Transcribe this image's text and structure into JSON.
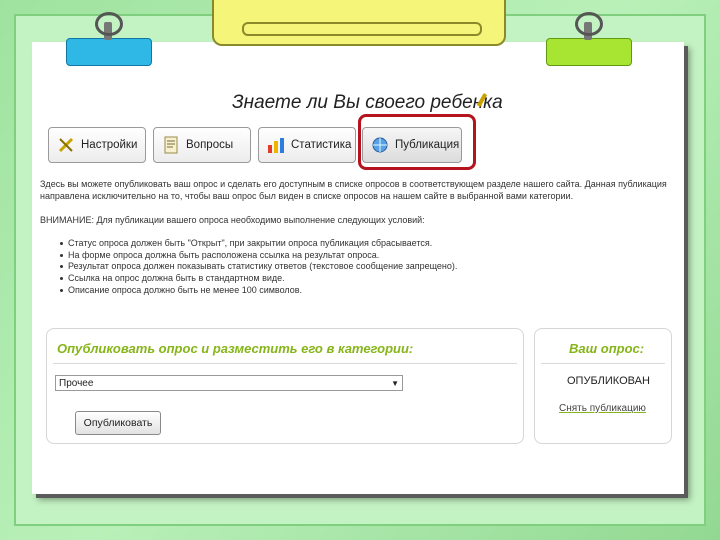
{
  "page": {
    "title": "Знаете ли Вы своего ребенка"
  },
  "tabs": [
    {
      "label": "Настройки",
      "icon": "tools-icon"
    },
    {
      "label": "Вопросы",
      "icon": "document-icon"
    },
    {
      "label": "Статистика",
      "icon": "chart-icon"
    },
    {
      "label": "Публикация",
      "icon": "globe-icon"
    }
  ],
  "content": {
    "intro_line1": "Здесь вы можете опубликовать ваш опрос и сделать его доступным в списке опросов в соответствующем разделе нашего сайта. Данная публикация",
    "intro_line2": "направлена исключительно на то, чтобы ваш опрос был виден в списке опросов на нашем сайте в выбранной вами категории.",
    "warning": "ВНИМАНИЕ: Для публикации вашего опроса необходимо выполнение следующих условий:",
    "rules": [
      "Статус опроса должен быть \"Открыт\", при закрытии опроса публикация сбрасывается.",
      "На форме опроса должна быть расположена ссылка на результат опроса.",
      "Результат опроса должен показывать статистику ответов (текстовое сообщение запрещено).",
      "Ссылка на опрос должна быть в стандартном виде.",
      "Описание опроса должно быть не менее 100 символов."
    ]
  },
  "publish_panel": {
    "heading": "Опубликовать опрос и разместить его в категории:",
    "selected_category": "Прочее",
    "button_label": "Опубликовать"
  },
  "your_poll_panel": {
    "heading": "Ваш опрос:",
    "status": "ОПУБЛИКОВАН",
    "link_label": "Снять публикацию"
  },
  "colors": {
    "accent_green": "#86b51a",
    "highlight_red": "#b5141f",
    "clip_blue": "#2fb7e6",
    "clip_green": "#a7e532",
    "tab_yellow": "#f5f57a"
  }
}
